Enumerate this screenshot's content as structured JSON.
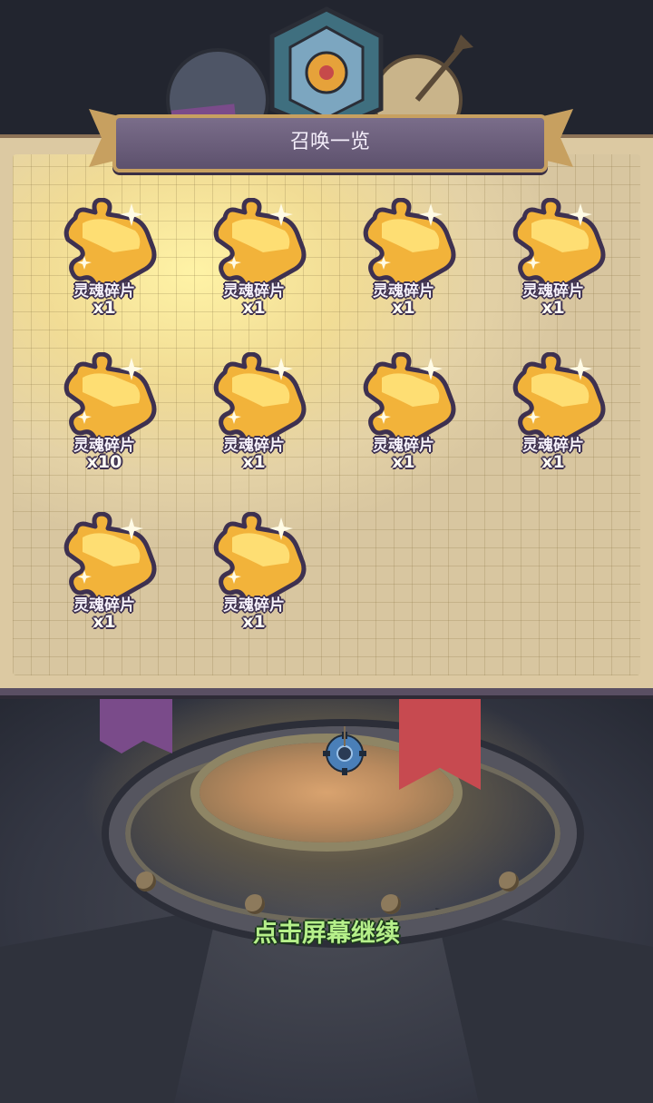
{
  "title": "召唤一览",
  "items": [
    {
      "label": "灵魂碎片",
      "count": "x1",
      "icon": "soul-fragment-puzzle-icon"
    },
    {
      "label": "灵魂碎片",
      "count": "x1",
      "icon": "soul-fragment-puzzle-icon"
    },
    {
      "label": "灵魂碎片",
      "count": "x1",
      "icon": "soul-fragment-puzzle-icon"
    },
    {
      "label": "灵魂碎片",
      "count": "x1",
      "icon": "soul-fragment-puzzle-icon"
    },
    {
      "label": "灵魂碎片",
      "count": "x10",
      "icon": "soul-fragment-puzzle-icon"
    },
    {
      "label": "灵魂碎片",
      "count": "x1",
      "icon": "soul-fragment-puzzle-icon"
    },
    {
      "label": "灵魂碎片",
      "count": "x1",
      "icon": "soul-fragment-puzzle-icon"
    },
    {
      "label": "灵魂碎片",
      "count": "x1",
      "icon": "soul-fragment-puzzle-icon"
    },
    {
      "label": "灵魂碎片",
      "count": "x1",
      "icon": "soul-fragment-puzzle-icon"
    },
    {
      "label": "灵魂碎片",
      "count": "x1",
      "icon": "soul-fragment-puzzle-icon"
    }
  ],
  "continue_hint": "点击屏幕继续",
  "colors": {
    "puzzle_gold": "#f2b33a",
    "puzzle_highlight": "#ffe27a",
    "outline": "#3e3150",
    "hint_green": "#b6f08a"
  }
}
